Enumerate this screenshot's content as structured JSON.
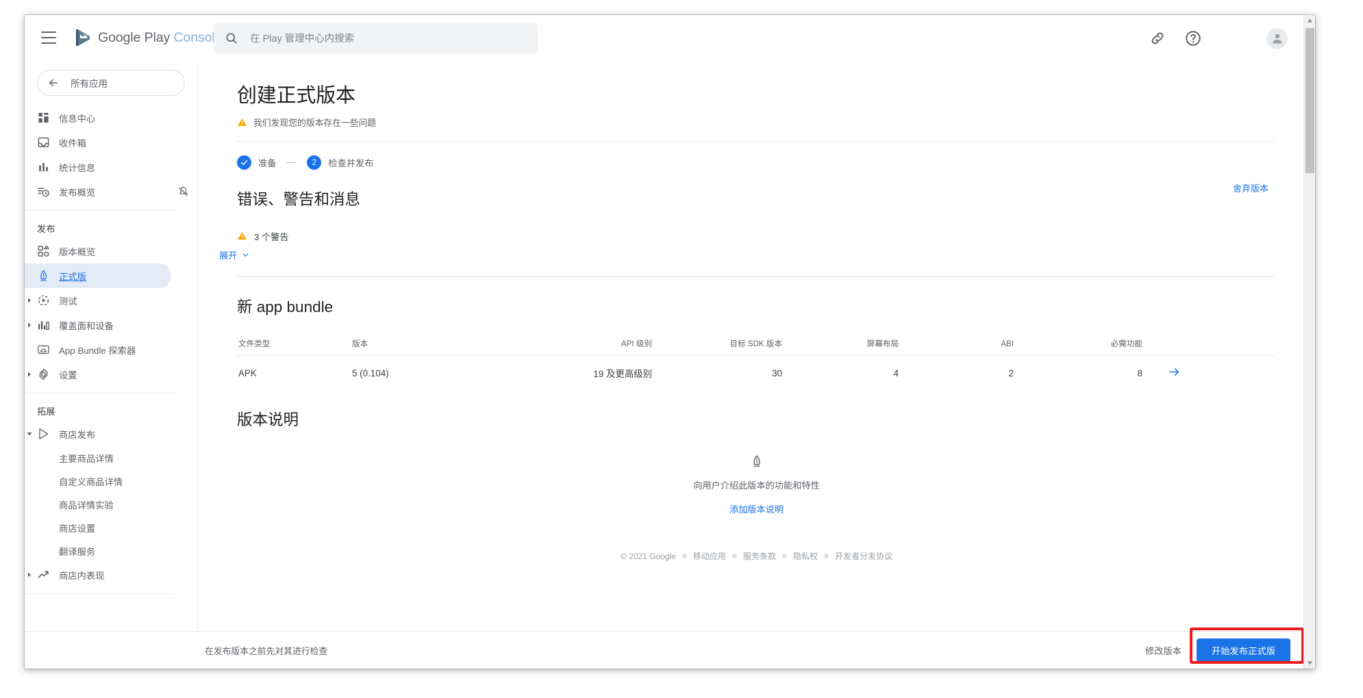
{
  "appbar": {
    "menu_label": "menu",
    "brand_google_play": "Google Play",
    "brand_console": "Console",
    "search_placeholder": "在 Play 管理中心内搜索",
    "link_icon": "link-icon",
    "help_icon": "help-icon",
    "avatar": "account-avatar"
  },
  "sidebar": {
    "all_apps": "所有应用",
    "items": [
      {
        "label": "信息中心",
        "icon": "dashboard-icon"
      },
      {
        "label": "收件箱",
        "icon": "inbox-icon"
      },
      {
        "label": "统计信息",
        "icon": "statistics-icon"
      },
      {
        "label": "发布概览",
        "icon": "release-overview-icon",
        "trailing": "notifications-off-icon"
      }
    ],
    "section_release": "发布",
    "release_items": [
      {
        "label": "版本概览",
        "icon": "release-dashboard-icon",
        "expandable": false,
        "active": false
      },
      {
        "label": "正式版",
        "icon": "production-icon",
        "expandable": false,
        "active": true
      },
      {
        "label": "测试",
        "icon": "testing-icon",
        "expandable": true,
        "active": false
      },
      {
        "label": "覆盖面和设备",
        "icon": "reach-devices-icon",
        "expandable": true,
        "active": false
      },
      {
        "label": "App Bundle 探索器",
        "icon": "app-bundle-explorer-icon",
        "expandable": false,
        "active": false
      },
      {
        "label": "设置",
        "icon": "settings-gear-icon",
        "expandable": true,
        "active": false
      }
    ],
    "section_grow": "拓展",
    "grow_items": [
      {
        "label": "商店发布",
        "icon": "store-presence-icon",
        "expandable": true,
        "expanded": true
      },
      {
        "label": "主要商品详情",
        "sub": true
      },
      {
        "label": "自定义商品详情",
        "sub": true
      },
      {
        "label": "商品详情实验",
        "sub": true
      },
      {
        "label": "商店设置",
        "sub": true
      },
      {
        "label": "翻译服务",
        "sub": true
      },
      {
        "label": "商店内表现",
        "icon": "store-performance-icon",
        "expandable": true
      }
    ]
  },
  "main": {
    "title": "创建正式版本",
    "subnote": "我们发现您的版本存在一些问题",
    "warning_icon": "warning-triangle-icon",
    "steps": [
      {
        "marker": "✓",
        "label": "准备",
        "state": "done"
      },
      {
        "marker": "2",
        "label": "检查并发布",
        "state": "current"
      }
    ],
    "discard_label": "舍弃版本",
    "errors_heading": "错误、警告和消息",
    "warning_count_text": "3 个警告",
    "expand_label": "展开",
    "bundle_heading": "新 app bundle",
    "table": {
      "columns": [
        "文件类型",
        "版本",
        "API 级别",
        "目标 SDK 版本",
        "屏幕布局",
        "ABI",
        "必需功能"
      ],
      "rows": [
        {
          "cells": [
            "APK",
            "5 (0.104)",
            "19 及更高级别",
            "30",
            "4",
            "2",
            "8"
          ],
          "action_icon": "arrow-right-icon"
        }
      ]
    },
    "notes_heading": "版本说明",
    "notes_empty_icon": "production-icon",
    "notes_empty_text": "向用户介绍此版本的功能和特性",
    "notes_add_link": "添加版本说明"
  },
  "footer": {
    "copyright": "© 2021 Google",
    "links": [
      "移动应用",
      "服务条款",
      "隐私权",
      "开发者分发协议"
    ]
  },
  "actionbar": {
    "hint": "在发布版本之前先对其进行检查",
    "secondary_label": "修改版本",
    "primary_label": "开始发布正式版"
  },
  "colors": {
    "accent": "#1a73e8",
    "warning": "#f9ab00",
    "muted": "#5f6368",
    "highlight_box": "#ee1c1c",
    "active_nav_bg": "#e4ebf7"
  }
}
